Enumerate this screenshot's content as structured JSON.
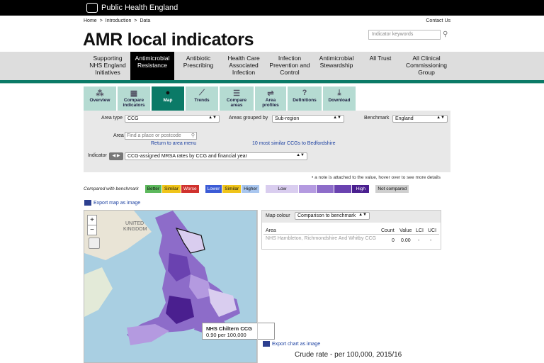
{
  "header": {
    "org": "Public Health England"
  },
  "breadcrumb": [
    "Home",
    ">",
    "Introduction",
    ">",
    "Data"
  ],
  "contact": "Contact Us",
  "page_title": "AMR local indicators",
  "search": {
    "placeholder": "Indicator keywords"
  },
  "nav": [
    {
      "label": "Supporting\nNHS England\nInitiatives",
      "active": false
    },
    {
      "label": "Antimicrobial\nResistance",
      "active": true
    },
    {
      "label": "Antibiotic\nPrescribing",
      "active": false
    },
    {
      "label": "Health Care\nAssociated\nInfection",
      "active": false
    },
    {
      "label": "Infection\nPrevention and\nControl",
      "active": false
    },
    {
      "label": "Antimicrobial\nStewardship",
      "active": false
    },
    {
      "label": "All Trust",
      "active": false
    },
    {
      "label": "All Clinical\nCommissioning\nGroup",
      "active": false
    }
  ],
  "tabs": [
    {
      "label": "Overview",
      "icon": "overview-icon",
      "glyph": "⁂"
    },
    {
      "label": "Compare\nindicators",
      "icon": "compare-indicators-icon",
      "glyph": "▦"
    },
    {
      "label": "Map",
      "icon": "map-pin-icon",
      "glyph": "●",
      "active": true
    },
    {
      "label": "Trends",
      "icon": "trends-icon",
      "glyph": "⟋"
    },
    {
      "label": "Compare\nareas",
      "icon": "compare-areas-icon",
      "glyph": "☰"
    },
    {
      "label": "Area\nprofiles",
      "icon": "area-profiles-icon",
      "glyph": "⇌"
    },
    {
      "label": "Definitions",
      "icon": "definitions-icon",
      "glyph": "?"
    },
    {
      "label": "Download",
      "icon": "download-icon",
      "glyph": "⤓"
    }
  ],
  "filters": {
    "area_type_label": "Area type",
    "area_type_value": "CCG",
    "grouped_by_label": "Areas grouped by",
    "grouped_by_value": "Sub-region",
    "benchmark_label": "Benchmark",
    "benchmark_value": "England",
    "area_label": "Area",
    "area_placeholder": "Find a place or postcode",
    "return_link": "Return to area menu",
    "similar_link": "10 most similar CCGs to Bedfordshire",
    "indicator_label": "Indicator",
    "indicator_value": "CCG-assigned MRSA rates by CCG and financial year"
  },
  "note": "• a note is attached to the value, hover over to see more details",
  "compared_label": "Compared with benchmark",
  "legend1": [
    {
      "label": "Better",
      "color": "#5cb85c"
    },
    {
      "label": "Similar",
      "color": "#f0c419"
    },
    {
      "label": "Worse",
      "color": "#d0312d"
    }
  ],
  "legend2": [
    {
      "label": "Lower",
      "color": "#3b5bd6"
    },
    {
      "label": "Similar",
      "color": "#f0c419"
    },
    {
      "label": "Higher",
      "color": "#a9c6ef"
    }
  ],
  "legend3": {
    "low": "Low",
    "high": "High",
    "not_compared": "Not compared"
  },
  "export_map": "Export map as image",
  "map": {
    "uk_label1": "UNITED",
    "uk_label2": "KINGDOM"
  },
  "tooltip": {
    "name": "NHS Chiltern CCG",
    "value": "0.90 per 100,000"
  },
  "right": {
    "map_colour_label": "Map colour",
    "map_colour_value": "Comparison to benchmark",
    "cols": [
      "Area",
      "Count",
      "Value",
      "LCI",
      "UCI"
    ],
    "row": {
      "area": "NHS Hambleton, Richmondshire And Whitby CCG",
      "count": "0",
      "value": "0.00",
      "lci": "-",
      "uci": "-"
    }
  },
  "export_chart": "Export chart as image",
  "chart_title": "Crude rate - per 100,000, 2015/16"
}
